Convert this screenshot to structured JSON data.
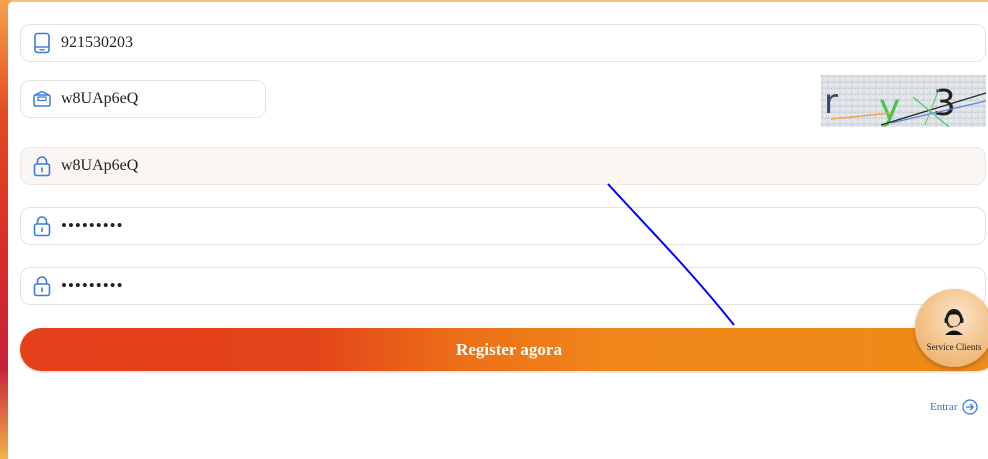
{
  "form": {
    "phone": {
      "value": "921530203",
      "icon": "phone-icon"
    },
    "captcha_input": {
      "value": "w8UAp6eQ",
      "icon": "message-icon"
    },
    "captcha_image": {
      "text": "ry3"
    },
    "username": {
      "value": "w8UAp6eQ",
      "icon": "lock-icon"
    },
    "password": {
      "value": "•••••••••",
      "icon": "lock-icon"
    },
    "confirm_password": {
      "value": "•••••••••",
      "icon": "lock-icon"
    },
    "register_label": "Register agora",
    "login_link": {
      "label": "Entrar",
      "icon": "arrow-right-circle-icon"
    }
  },
  "service": {
    "label": "Service Clients",
    "icon": "headset-icon"
  },
  "colors": {
    "accent_blue": "#3a7bdc",
    "button_start": "#e43f1b",
    "button_end": "#ef8b19",
    "annotation_line": "#0000ff"
  }
}
